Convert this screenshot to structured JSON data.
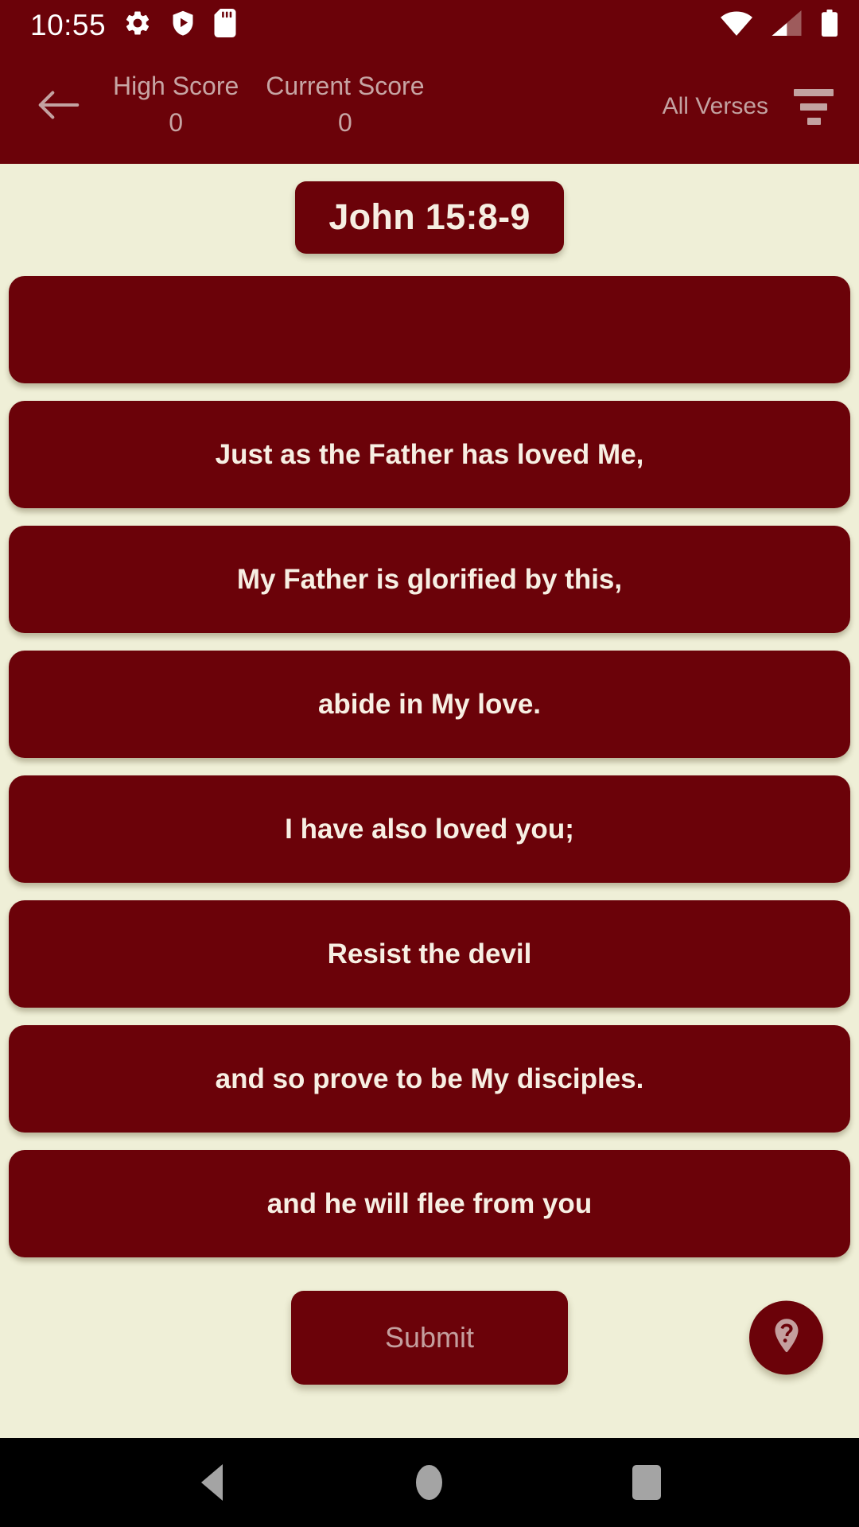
{
  "status_bar": {
    "time": "10:55",
    "left_icons": [
      "gear-icon",
      "shield-play-icon",
      "sd-card-icon"
    ],
    "right_icons": [
      "wifi-icon",
      "cell-signal-icon",
      "battery-icon"
    ],
    "background_color": "#6B0209",
    "foreground_color": "#FFFFFF"
  },
  "app_bar": {
    "back_icon": "back-arrow-icon",
    "high_score_label": "High Score",
    "high_score_value": "0",
    "current_score_label": "Current Score",
    "current_score_value": "0",
    "filter_label": "All Verses",
    "filter_icon": "filter-icon",
    "background_color": "#6B0209",
    "text_color": "#C7A5A4"
  },
  "main": {
    "verse_title": "John 15:8-9",
    "background_color": "#EFEFD7",
    "card_color": "#6B0209",
    "card_text_color": "#F7EFE3",
    "cards": [
      {
        "text": "",
        "empty": true
      },
      {
        "text": "Just as the Father has loved Me,",
        "empty": false
      },
      {
        "text": "My Father is glorified by this,",
        "empty": false
      },
      {
        "text": "abide in My love.",
        "empty": false
      },
      {
        "text": "I have also loved you;",
        "empty": false
      },
      {
        "text": "Resist the devil",
        "empty": false
      },
      {
        "text": "and so prove to be My disciples.",
        "empty": false
      },
      {
        "text": "and he will flee from you",
        "empty": false
      }
    ]
  },
  "actions": {
    "submit_label": "Submit",
    "submit_text_color": "#C49F9E",
    "help_icon": "help-pin-icon"
  },
  "nav_bar": {
    "back_icon": "nav-back-icon",
    "home_icon": "nav-home-icon",
    "recents_icon": "nav-recents-icon",
    "background_color": "#000000",
    "icon_color": "#A4A4A4"
  }
}
